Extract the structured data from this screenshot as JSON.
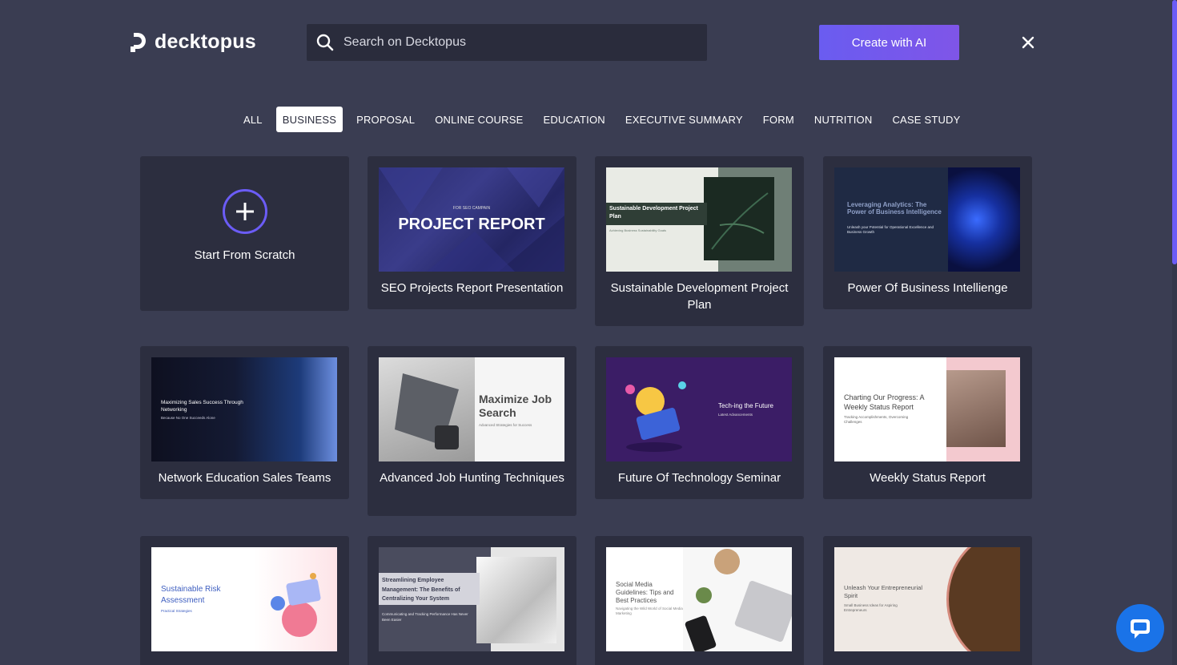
{
  "header": {
    "logo_text": "decktopus",
    "search_placeholder": "Search on Decktopus",
    "create_label": "Create with AI"
  },
  "tabs": [
    {
      "label": "ALL",
      "active": false
    },
    {
      "label": "BUSINESS",
      "active": true
    },
    {
      "label": "PROPOSAL",
      "active": false
    },
    {
      "label": "ONLINE COURSE",
      "active": false
    },
    {
      "label": "EDUCATION",
      "active": false
    },
    {
      "label": "EXECUTIVE SUMMARY",
      "active": false
    },
    {
      "label": "FORM",
      "active": false
    },
    {
      "label": "NUTRITION",
      "active": false
    },
    {
      "label": "CASE STUDY",
      "active": false
    }
  ],
  "scratch": {
    "label": "Start From Scratch"
  },
  "templates": [
    {
      "title": "SEO Projects Report Presentation",
      "thumb_small": "FOR SEO CAMPAIN",
      "thumb_big": "PROJECT REPORT"
    },
    {
      "title": "Sustainable Development Project Plan",
      "thumb_big": "Sustainable Development Project Plan",
      "thumb_small": "Achieving Business Sustainability Goals"
    },
    {
      "title": "Power Of Business Intellienge",
      "thumb_big": "Leveraging Analytics: The Power of Business Intelligence",
      "thumb_small": "Unleash your Potential for Operational Excellence and Business Growth"
    },
    {
      "title": "Network Education Sales Teams",
      "thumb_big": "Maximizing Sales Success Through Networking",
      "thumb_small": "Because No One Succeeds Alone"
    },
    {
      "title": "Advanced Job Hunting Techniques",
      "thumb_big": "Maximize Job Search",
      "thumb_small": "Advanced Strategies for Success"
    },
    {
      "title": "Future Of Technology Seminar",
      "thumb_big": "Tech-ing the Future",
      "thumb_small": "Latest Advancements"
    },
    {
      "title": "Weekly Status Report",
      "thumb_big": "Charting Our Progress: A Weekly Status Report",
      "thumb_small": "Tracking Accomplishments, Overcoming Challenges"
    },
    {
      "title": "",
      "thumb_big": "Sustainable Risk Assessment",
      "thumb_small": "Practical Strategies"
    },
    {
      "title": "",
      "thumb_big": "Streamlining Employee Management: The Benefits of Centralizing Your System",
      "thumb_small": "Communicating and Tracking Performance Has Never Been Easier"
    },
    {
      "title": "",
      "thumb_big": "Social Media Guidelines: Tips and Best Practices",
      "thumb_small": "Navigating the Wild World of Social Media Marketing"
    },
    {
      "title": "",
      "thumb_big": "Unleash Your Entrepreneurial Spirit",
      "thumb_small": "Small Business Ideas for Aspiring Entrepreneurs"
    }
  ],
  "colors": {
    "background": "#3a3d52",
    "card": "#2c2e3f",
    "accent": "#6b5cf6"
  }
}
